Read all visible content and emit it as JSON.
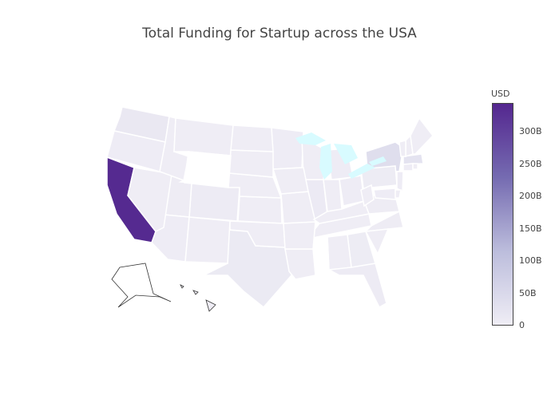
{
  "chart_data": {
    "type": "choropleth",
    "title": "Total Funding for Startup across the USA",
    "geo_scope": "usa",
    "colorbar": {
      "title": "USD",
      "range": [
        0,
        345000000000
      ],
      "ticks": [
        {
          "value": 0,
          "label": "0"
        },
        {
          "value": 50000000000,
          "label": "50B"
        },
        {
          "value": 100000000000,
          "label": "100B"
        },
        {
          "value": 150000000000,
          "label": "150B"
        },
        {
          "value": 200000000000,
          "label": "200B"
        },
        {
          "value": 250000000000,
          "label": "250B"
        },
        {
          "value": 300000000000,
          "label": "300B"
        }
      ],
      "colors": [
        "#efedf5",
        "#bcbddc",
        "#756bb1",
        "#54278f"
      ]
    },
    "no_data_color": "#ffffff",
    "lake_color": "#d8fbff",
    "states": [
      {
        "state": "CA",
        "value": 340000000000
      },
      {
        "state": "NY",
        "value": 35000000000
      },
      {
        "state": "MA",
        "value": 25000000000
      },
      {
        "state": "WA",
        "value": 12000000000
      },
      {
        "state": "TX",
        "value": 8000000000
      },
      {
        "state": "IL",
        "value": 6000000000
      },
      {
        "state": "CO",
        "value": 4000000000
      },
      {
        "state": "FL",
        "value": 4000000000
      },
      {
        "state": "GA",
        "value": 3500000000
      },
      {
        "state": "PA",
        "value": 3500000000
      },
      {
        "state": "VA",
        "value": 3000000000
      },
      {
        "state": "NC",
        "value": 2500000000
      },
      {
        "state": "UT",
        "value": 2500000000
      },
      {
        "state": "NJ",
        "value": 2000000000
      },
      {
        "state": "MD",
        "value": 2000000000
      },
      {
        "state": "OR",
        "value": 2000000000
      },
      {
        "state": "MN",
        "value": 2000000000
      },
      {
        "state": "MI",
        "value": 1500000000
      },
      {
        "state": "OH",
        "value": 1500000000
      },
      {
        "state": "AZ",
        "value": 1500000000
      },
      {
        "state": "CT",
        "value": 1500000000
      },
      {
        "state": "MO",
        "value": 1000000000
      },
      {
        "state": "TN",
        "value": 1000000000
      },
      {
        "state": "WI",
        "value": 1000000000
      },
      {
        "state": "IN",
        "value": 1000000000
      },
      {
        "state": "NV",
        "value": 1000000000
      },
      {
        "state": "NH",
        "value": 500000000
      },
      {
        "state": "RI",
        "value": 500000000
      },
      {
        "state": "DE",
        "value": 500000000
      },
      {
        "state": "KS",
        "value": 500000000
      },
      {
        "state": "KY",
        "value": 500000000
      },
      {
        "state": "SC",
        "value": 500000000
      },
      {
        "state": "AL",
        "value": 500000000
      },
      {
        "state": "LA",
        "value": 500000000
      },
      {
        "state": "IA",
        "value": 500000000
      },
      {
        "state": "NE",
        "value": 500000000
      },
      {
        "state": "OK",
        "value": 500000000
      },
      {
        "state": "NM",
        "value": 500000000
      },
      {
        "state": "ID",
        "value": 300000000
      },
      {
        "state": "MT",
        "value": 300000000
      },
      {
        "state": "ME",
        "value": 300000000
      },
      {
        "state": "VT",
        "value": 300000000
      },
      {
        "state": "AR",
        "value": 300000000
      },
      {
        "state": "WV",
        "value": 200000000
      },
      {
        "state": "SD",
        "value": 100000000
      },
      {
        "state": "ND",
        "value": 100000000
      },
      {
        "state": "HI",
        "value": 100000000
      },
      {
        "state": "MS",
        "value": null
      },
      {
        "state": "WY",
        "value": null
      },
      {
        "state": "AK",
        "value": null
      }
    ]
  }
}
